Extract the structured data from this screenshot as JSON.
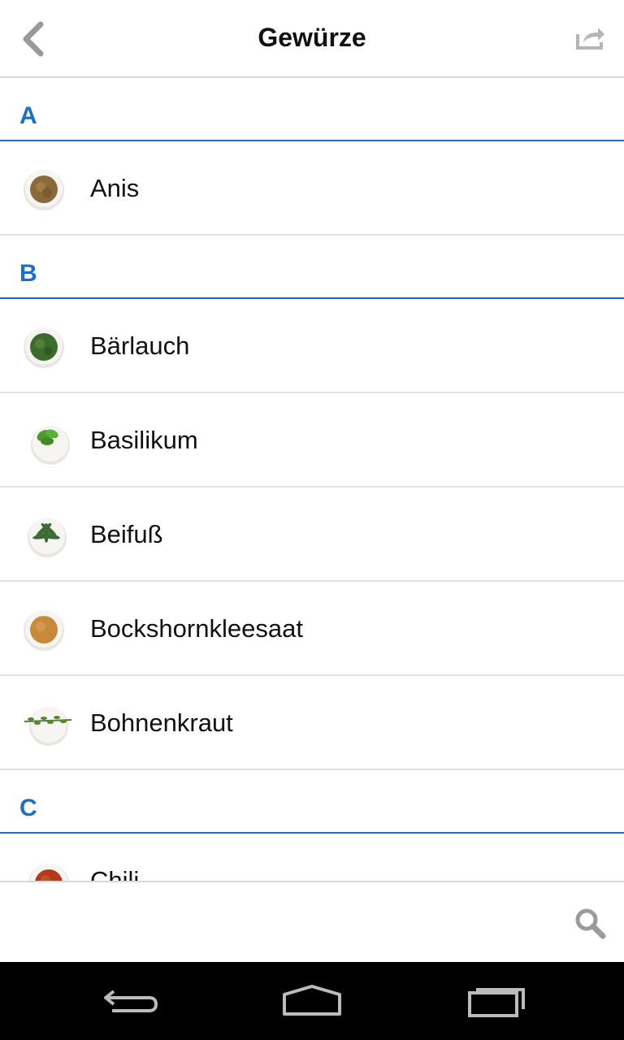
{
  "header": {
    "title": "Gewürze"
  },
  "sections": [
    {
      "letter": "A",
      "items": [
        {
          "label": "Anis",
          "icon": "anis-icon"
        }
      ]
    },
    {
      "letter": "B",
      "items": [
        {
          "label": "Bärlauch",
          "icon": "baerlauch-icon"
        },
        {
          "label": "Basilikum",
          "icon": "basilikum-icon"
        },
        {
          "label": "Beifuß",
          "icon": "beifuss-icon"
        },
        {
          "label": "Bockshornkleesaat",
          "icon": "bockshornkleesaat-icon"
        },
        {
          "label": "Bohnenkraut",
          "icon": "bohnenkraut-icon"
        }
      ]
    },
    {
      "letter": "C",
      "items": [
        {
          "label": "Chili",
          "icon": "chili-icon"
        }
      ]
    }
  ],
  "colors": {
    "accent": "#1f6fc0",
    "divider": "#e2e2e2"
  }
}
